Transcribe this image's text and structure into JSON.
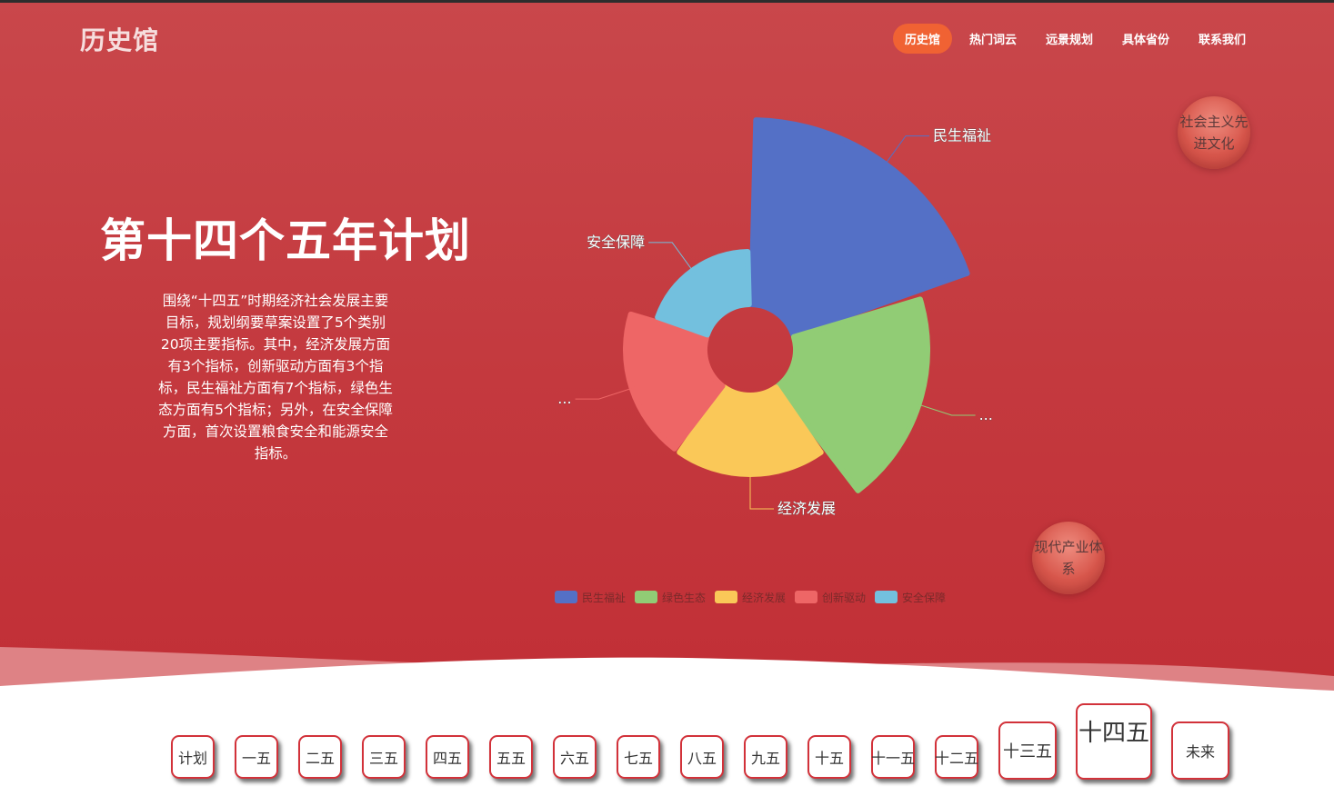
{
  "site": {
    "logo": "历史馆"
  },
  "nav": {
    "items": [
      "历史馆",
      "热门词云",
      "远景规划",
      "具体省份",
      "联系我们"
    ],
    "active_index": 0
  },
  "hero": {
    "title": "第十四个五年计划",
    "description": "围绕“十四五”时期经济社会发展主要目标，规划纲要草案设置了5个类别20项主要指标。其中，经济发展方面有3个指标，创新驱动方面有3个指标，民生福祉方面有7个指标，绿色生态方面有5个指标；另外，在安全保障方面，首次设置粮食安全和能源安全指标。"
  },
  "bubbles": [
    "社会主义先进文化",
    "现代产业体系"
  ],
  "chart_data": {
    "type": "pie",
    "variant": "rose",
    "categories": [
      "民生福祉",
      "绿色生态",
      "经济发展",
      "创新驱动",
      "安全保障"
    ],
    "values": [
      7,
      5,
      3,
      3,
      2
    ],
    "colors": [
      "#5470c6",
      "#91cc75",
      "#fac858",
      "#ee6666",
      "#73c0de"
    ],
    "outside_labels": [
      "民生福祉",
      "...",
      "经济发展",
      "...",
      "安全保障"
    ],
    "legend_position": "bottom-center"
  },
  "timeline": {
    "items": [
      "计划",
      "一五",
      "二五",
      "三五",
      "四五",
      "五五",
      "六五",
      "七五",
      "八五",
      "九五",
      "十五",
      "十一五",
      "十二五",
      "十三五",
      "十四五",
      "未来"
    ],
    "active": "十四五"
  }
}
